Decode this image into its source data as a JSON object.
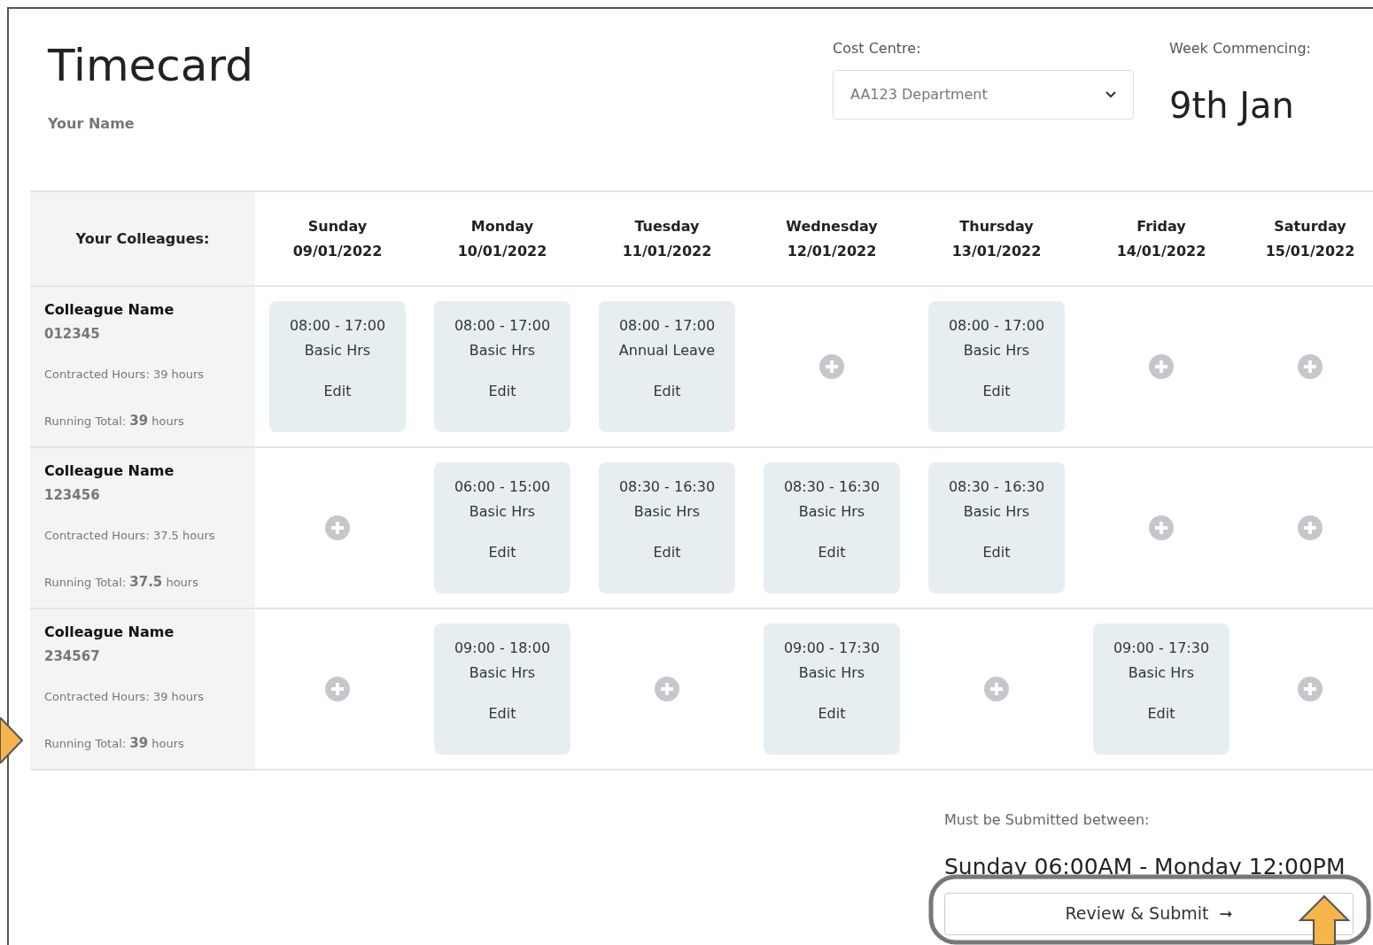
{
  "header": {
    "title": "Timecard",
    "user_name": "Your Name",
    "cost_centre": {
      "label": "Cost Centre:",
      "value": "AA123 Department"
    },
    "week": {
      "label": "Week Commencing:",
      "value": "9th Jan"
    }
  },
  "table": {
    "corner_label": "Your Colleagues:",
    "days": [
      {
        "day": "Sunday",
        "date": "09/01/2022"
      },
      {
        "day": "Monday",
        "date": "10/01/2022"
      },
      {
        "day": "Tuesday",
        "date": "11/01/2022"
      },
      {
        "day": "Wednesday",
        "date": "12/01/2022"
      },
      {
        "day": "Thursday",
        "date": "13/01/2022"
      },
      {
        "day": "Friday",
        "date": "14/01/2022"
      },
      {
        "day": "Saturday",
        "date": "15/01/2022"
      }
    ],
    "rows": [
      {
        "name": "Colleague Name",
        "id": "012345",
        "contracted": "Contracted Hours: 39 hours",
        "running_total": "Running Total: **39** hours",
        "cells": [
          {
            "kind": "shift",
            "time": "08:00 - 17:00",
            "type": "Basic Hrs",
            "action": "Edit"
          },
          {
            "kind": "shift",
            "time": "08:00 - 17:00",
            "type": "Basic Hrs",
            "action": "Edit"
          },
          {
            "kind": "shift",
            "time": "08:00 - 17:00",
            "type": "Annual Leave",
            "action": "Edit"
          },
          {
            "kind": "add"
          },
          {
            "kind": "shift",
            "time": "08:00 - 17:00",
            "type": "Basic Hrs",
            "action": "Edit"
          },
          {
            "kind": "add"
          },
          {
            "kind": "add"
          }
        ]
      },
      {
        "name": "Colleague Name",
        "id": "123456",
        "contracted": "Contracted Hours: 37.5 hours",
        "running_total": "Running Total: **37.5** hours",
        "cells": [
          {
            "kind": "add"
          },
          {
            "kind": "shift",
            "time": "06:00 - 15:00",
            "type": "Basic Hrs",
            "action": "Edit"
          },
          {
            "kind": "shift",
            "time": "08:30 - 16:30",
            "type": "Basic Hrs",
            "action": "Edit"
          },
          {
            "kind": "shift",
            "time": "08:30 - 16:30",
            "type": "Basic Hrs",
            "action": "Edit"
          },
          {
            "kind": "shift",
            "time": "08:30 - 16:30",
            "type": "Basic Hrs",
            "action": "Edit"
          },
          {
            "kind": "add"
          },
          {
            "kind": "add"
          }
        ]
      },
      {
        "name": "Colleague Name",
        "id": "234567",
        "contracted": "Contracted Hours: 39 hours",
        "running_total": "Running Total: **39** hours",
        "cells": [
          {
            "kind": "add"
          },
          {
            "kind": "shift",
            "time": "09:00 - 18:00",
            "type": "Basic Hrs",
            "action": "Edit"
          },
          {
            "kind": "add"
          },
          {
            "kind": "shift",
            "time": "09:00 - 17:30",
            "type": "Basic Hrs",
            "action": "Edit"
          },
          {
            "kind": "add"
          },
          {
            "kind": "shift",
            "time": "09:00 - 17:30",
            "type": "Basic Hrs",
            "action": "Edit"
          },
          {
            "kind": "add"
          }
        ]
      }
    ]
  },
  "submission": {
    "label": "Must be Submitted between:",
    "window": "Sunday 06:00AM - Monday 12:00PM",
    "button": "Review & Submit",
    "button_icon": "➞"
  }
}
